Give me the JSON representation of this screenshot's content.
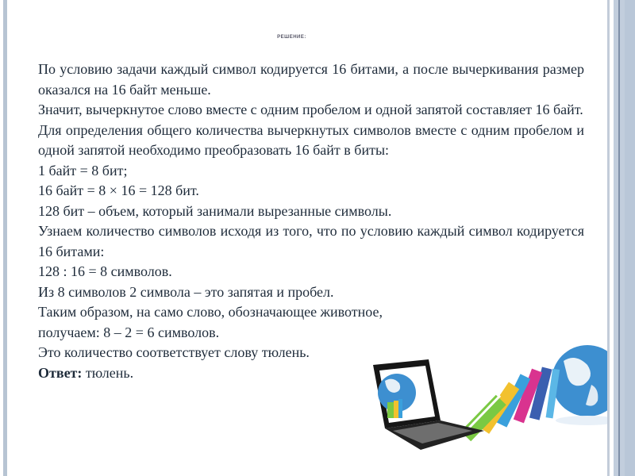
{
  "slide": {
    "heading": "РЕШЕНИЕ:",
    "paragraphs": [
      "По условию задачи каждый символ кодируется 16 битами, а после вычеркивания размер оказался на 16 байт меньше.",
      "Значит, вычеркнутое слово вместе с одним пробелом и одной запятой составляет 16 байт.",
      "Для определения общего количества вычеркнутых символов вместе с одним пробелом и одной запятой необходимо преобразовать 16 байт в биты:",
      "1 байт = 8 бит;",
      "16 байт = 8 × 16 = 128 бит.",
      "128 бит – объем, который занимали вырезанные символы.",
      "Узнаем количество символов исходя из того, что по условию каждый символ кодируется 16 битами:",
      "128 : 16 = 8 символов.",
      "Из 8 символов 2 символа – это запятая и пробел.",
      "Таким образом, на само слово, обозначающее животное,",
      "получаем: 8 – 2 = 6 символов.",
      "Это количество соответствует слову тюлень."
    ],
    "answer": {
      "label": "Ответ:",
      "value": " тюлень."
    }
  },
  "illustration": {
    "description": "laptop-books-globe-clipart",
    "colors": {
      "laptop": "#1a1a1a",
      "globe": "#2f86c9",
      "book_green": "#7ac943",
      "book_yellow": "#f2c12e",
      "book_blue": "#3aa0dc",
      "book_pink": "#d9338f",
      "book_light_blue": "#5bb7e6"
    }
  },
  "theme": {
    "text_color": "#1e2b3a",
    "frame_color": "#b7c4d3",
    "background": "#ffffff"
  }
}
